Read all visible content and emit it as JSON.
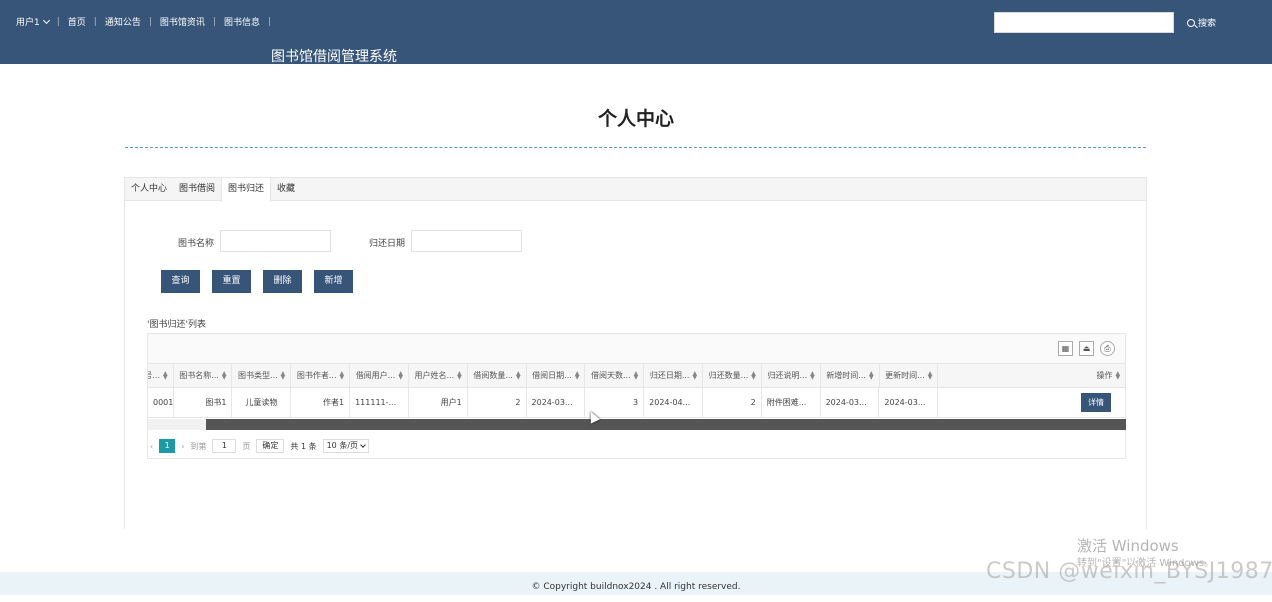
{
  "header": {
    "user": "用户1",
    "nav": [
      "首页",
      "通知公告",
      "图书馆资讯",
      "图书信息"
    ],
    "site_title": "图书馆借阅管理系统",
    "search_label": "搜索",
    "search_value": ""
  },
  "page": {
    "title": "个人中心",
    "tabs": [
      "个人中心",
      "图书借阅",
      "图书归还",
      "收藏"
    ],
    "active_tab": "图书归还"
  },
  "filters": {
    "book_name_label": "图书名称",
    "return_date_label": "归还日期"
  },
  "buttons": {
    "query": "查询",
    "reset": "重置",
    "delete": "删除",
    "add": "新增"
  },
  "list_title": "'图书归还'列表",
  "table": {
    "headers": [
      "...号...",
      "图书名称...",
      "图书类型...",
      "图书作者...",
      "借阅用户...",
      "用户姓名...",
      "借阅数量...",
      "借阅日期...",
      "借阅天数...",
      "归还日期...",
      "归还数量...",
      "归还说明...",
      "新增时间...",
      "更新时间...",
      "操作"
    ],
    "header_display": [
      "号...",
      "图书名称...",
      "图书类型...",
      "图书作者...",
      "借阅用户...",
      "用户姓名...",
      "借阅数量...",
      "借阅日期...",
      "借阅天数...",
      "归还日期...",
      "归还数量...",
      "归还说明...",
      "新增时间...",
      "更新时间...",
      "操作"
    ],
    "rows": [
      [
        "0001",
        "图书1",
        "儿童读物",
        "作者1",
        "111111-...",
        "用户1",
        "2",
        "2024-03...",
        "3",
        "2024-04...",
        "2",
        "附件困难...",
        "2024-03...",
        "2024-03..."
      ]
    ],
    "detail_label": "详情"
  },
  "pagination": {
    "current": "1",
    "goto_label": "到第",
    "goto_value": "1",
    "page_unit": "页",
    "confirm": "确定",
    "total": "共 1 条",
    "page_size": "10 条/页"
  },
  "footer": "© Copyright buildnox2024 . All right reserved.",
  "overlay": {
    "win_line1": "激活 Windows",
    "win_line2": "转到\"设置\"以激活 Windows。",
    "watermark": "CSDN @weixin_BYSJ1987"
  }
}
